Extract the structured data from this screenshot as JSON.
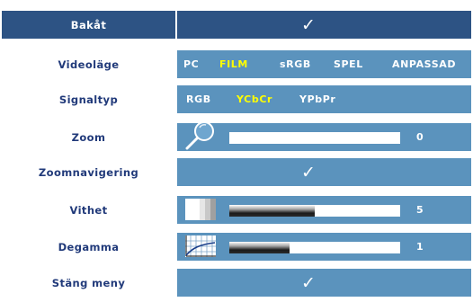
{
  "menu": {
    "back": {
      "label": "Bakåt"
    },
    "video_mode": {
      "label": "Videoläge",
      "options": [
        "PC",
        "FILM",
        "sRGB",
        "SPEL",
        "ANPASSAD"
      ],
      "selected": "FILM"
    },
    "signal_type": {
      "label": "Signaltyp",
      "options": [
        "RGB",
        "YCbCr",
        "YPbPr"
      ],
      "selected": "YCbCr"
    },
    "zoom": {
      "label": "Zoom",
      "value": "0",
      "level": 0.0
    },
    "zoom_navigation": {
      "label": "Zoomnavigering"
    },
    "white_level": {
      "label": "Vithet",
      "value": "5",
      "level": 0.5
    },
    "degamma": {
      "label": "Degamma",
      "value": "1",
      "level": 0.35
    },
    "close_menu": {
      "label": "Stäng meny"
    }
  },
  "colors": {
    "label_text": "#213a7a",
    "panel": "#5b93bd",
    "highlight_row": "#2d5384",
    "selected_option": "#ffff00"
  },
  "icons": {
    "check": "checkmark-icon",
    "zoom": "magnifier-icon",
    "white_level": "whiteness-gradient-icon",
    "degamma": "gamma-curve-icon"
  }
}
